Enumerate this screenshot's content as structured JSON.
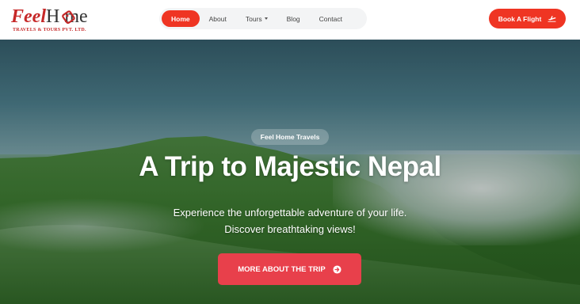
{
  "brand": {
    "logo_main_feel": "Feel",
    "logo_main_home": "H  me",
    "logo_sub": "TRAVELS & TOURS PVT. LTD."
  },
  "nav": {
    "items": [
      {
        "label": "Home",
        "active": true
      },
      {
        "label": "About",
        "active": false
      },
      {
        "label": "Tours",
        "active": false,
        "has_dropdown": true
      },
      {
        "label": "Blog",
        "active": false
      },
      {
        "label": "Contact",
        "active": false
      }
    ]
  },
  "header_cta": {
    "label": "Book A Flight",
    "icon": "plane-icon"
  },
  "hero": {
    "badge": "Feel Home Travels",
    "title": "A Trip to Majestic Nepal",
    "subtitle_line1": "Experience the unforgettable adventure of your life.",
    "subtitle_line2": "Discover breathtaking views!",
    "button_label": "MORE ABOUT THE TRIP",
    "button_icon": "arrow-right-circle-icon"
  },
  "colors": {
    "accent": "#ef3523",
    "hero_button": "#e8404b",
    "nav_bg": "#f3f4f5"
  }
}
